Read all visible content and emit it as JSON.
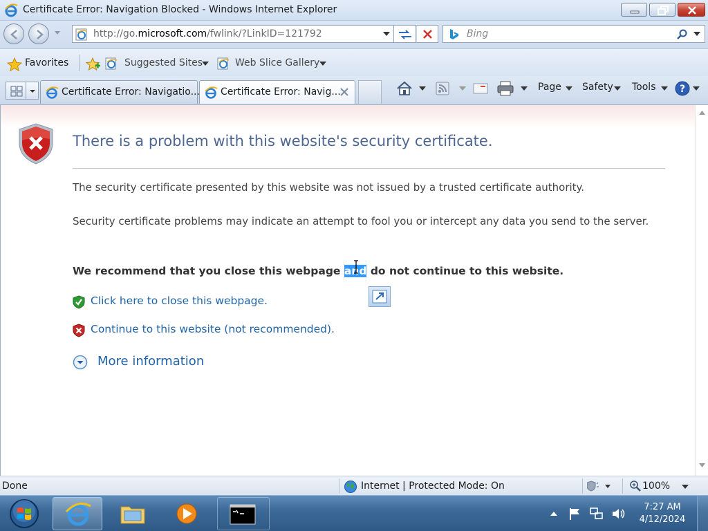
{
  "window": {
    "title": "Certificate Error: Navigation Blocked - Windows Internet Explorer"
  },
  "address_bar": {
    "url_prefix": "http://go.",
    "url_domain": "microsoft.com",
    "url_suffix": "/fwlink/?LinkID=121792"
  },
  "search": {
    "placeholder": "Bing"
  },
  "favorites_bar": {
    "favorites_label": "Favorites",
    "items": [
      {
        "label": "Suggested Sites"
      },
      {
        "label": "Web Slice Gallery"
      }
    ]
  },
  "tabs": [
    {
      "label": "Certificate Error: Navigatio...",
      "active": false
    },
    {
      "label": "Certificate Error: Navig...",
      "active": true
    }
  ],
  "command_bar": {
    "page": "Page",
    "safety": "Safety",
    "tools": "Tools"
  },
  "content": {
    "heading": "There is a problem with this website's security certificate.",
    "para1": "The security certificate presented by this website was not issued by a trusted certificate authority.",
    "para2": "Security certificate problems may indicate an attempt to fool you or intercept any data you send to the server.",
    "recommend_before": "We recommend that you close this webpage ",
    "recommend_selected": "and",
    "recommend_after": " do not continue to this website.",
    "close_link": "Click here to close this webpage.",
    "continue_link": "Continue to this website (not recommended).",
    "more_info": "More information"
  },
  "status_bar": {
    "status": "Done",
    "zone": "Internet | Protected Mode: On",
    "zoom": "100%"
  },
  "taskbar": {
    "time": "7:27 AM",
    "date": "4/12/2024"
  },
  "colors": {
    "heading": "#4e6792",
    "link": "#2164a6",
    "selection": "#3399ff"
  }
}
